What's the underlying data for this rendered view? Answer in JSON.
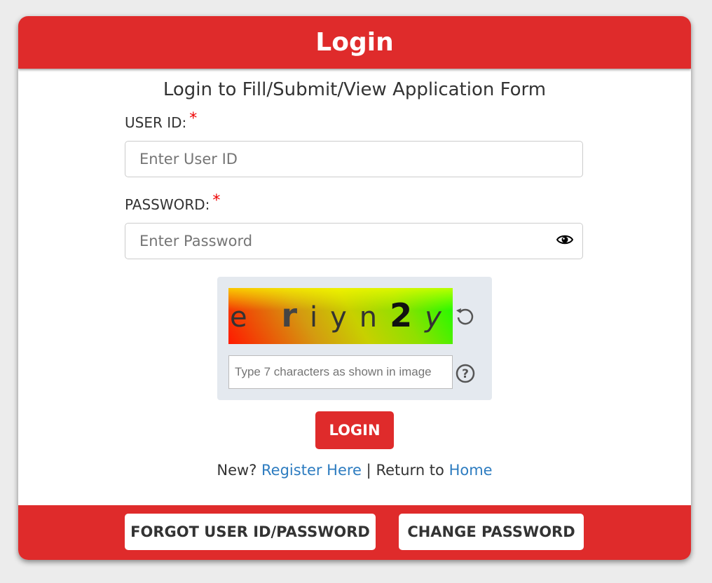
{
  "header": {
    "title": "Login"
  },
  "subtitle": "Login to Fill/Submit/View Application Form",
  "form": {
    "user_id": {
      "label": "USER ID:",
      "required_mark": "*",
      "placeholder": "Enter User ID",
      "value": ""
    },
    "password": {
      "label": "PASSWORD:",
      "required_mark": "*",
      "placeholder": "Enter Password",
      "value": "",
      "toggle_icon": "eye-icon"
    },
    "captcha": {
      "image_text_parts": [
        "e ",
        "r",
        "iyn",
        "2",
        "y"
      ],
      "refresh_icon": "refresh-icon",
      "input_placeholder": "Type 7 characters as shown in image",
      "help_icon": "question-circle-icon"
    },
    "login_label": "LOGIN"
  },
  "links": {
    "new_prefix": "New?",
    "register_label": "Register Here",
    "separator": "|",
    "return_prefix": "Return to",
    "home_label": "Home"
  },
  "footer": {
    "forgot_label": "FORGOT USER ID/PASSWORD",
    "change_password_label": "CHANGE PASSWORD"
  },
  "colors": {
    "brand_red": "#df2b2b",
    "link_blue": "#2d7cc0",
    "required_red": "#ee0000"
  }
}
